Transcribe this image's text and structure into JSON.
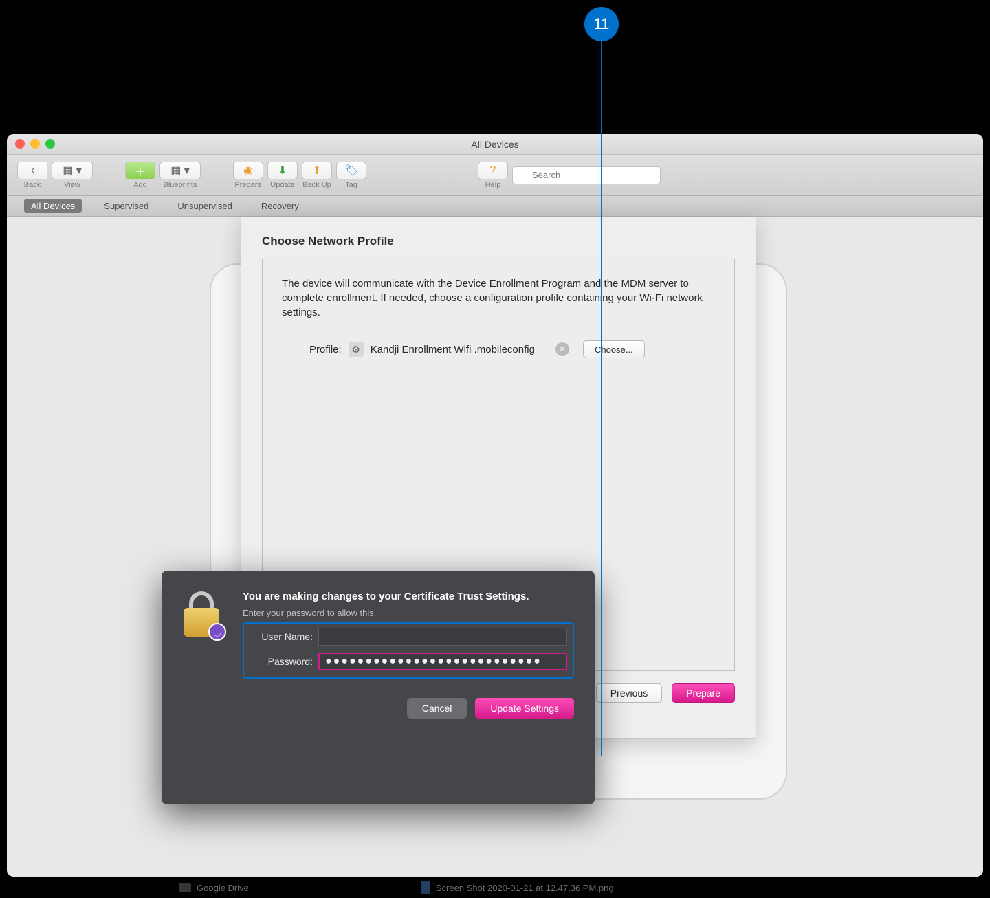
{
  "annotation": {
    "number": "11"
  },
  "window": {
    "title": "All Devices",
    "toolbar": {
      "back": "Back",
      "view": "View",
      "add": "Add",
      "blueprints": "Blueprints",
      "prepare": "Prepare",
      "update": "Update",
      "backup": "Back Up",
      "tag": "Tag",
      "help": "Help",
      "search_placeholder": "Search"
    },
    "tabs": {
      "all": "All Devices",
      "supervised": "Supervised",
      "unsupervised": "Unsupervised",
      "recovery": "Recovery"
    }
  },
  "sheet": {
    "title": "Choose Network Profile",
    "description": "The device will communicate with the Device Enrollment Program and the MDM server to complete enrollment. If needed, choose a configuration profile containing your Wi-Fi network settings.",
    "profile_label": "Profile:",
    "profile_name": "Kandji Enrollment Wifi .mobileconfig",
    "choose_btn": "Choose...",
    "previous_btn": "Previous",
    "prepare_btn": "Prepare"
  },
  "auth": {
    "title": "You are making changes to your Certificate Trust Settings.",
    "subtitle": "Enter your password to allow this.",
    "username_label": "User Name:",
    "username_value": "",
    "password_label": "Password:",
    "password_value": "●●●●●●●●●●●●●●●●●●●●●●●●●●●",
    "cancel": "Cancel",
    "update": "Update Settings"
  },
  "finder": {
    "folder": "Google Drive",
    "file": "Screen Shot 2020-01-21 at 12.47.36 PM.png"
  }
}
